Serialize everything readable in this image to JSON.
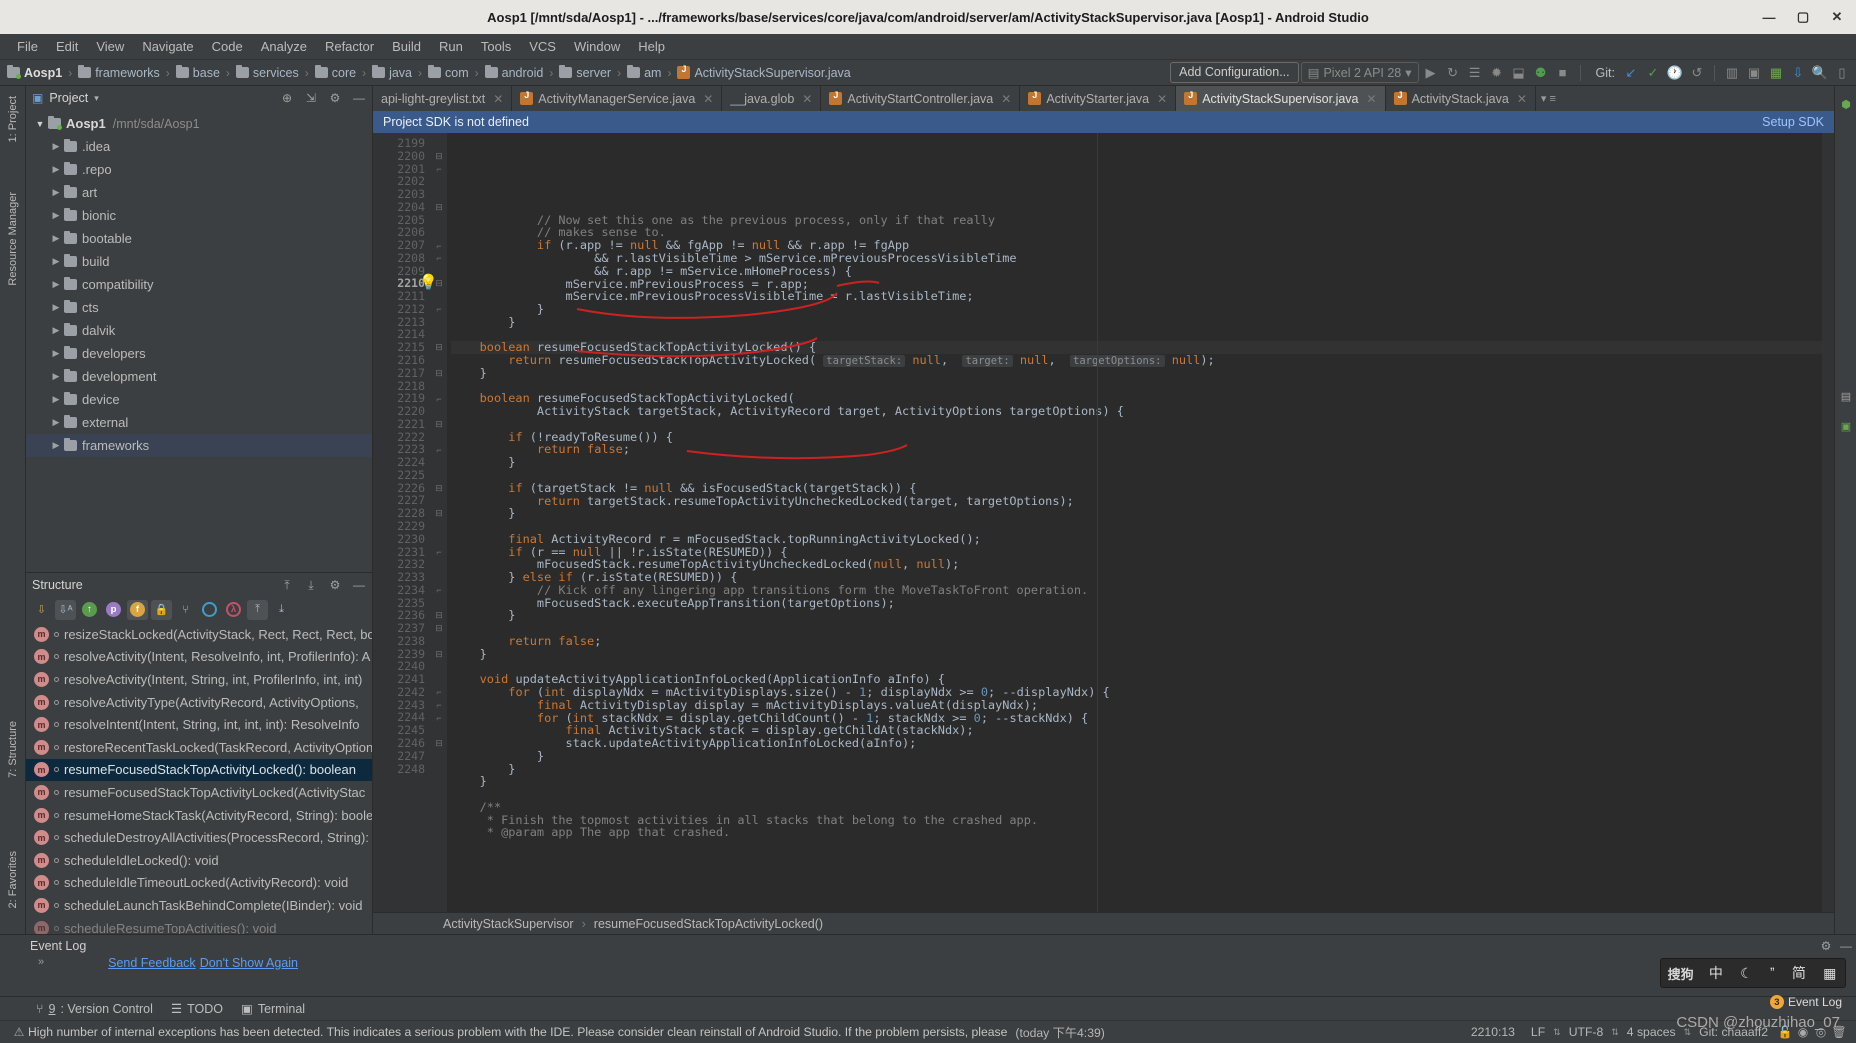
{
  "window": {
    "title": "Aosp1 [/mnt/sda/Aosp1] - .../frameworks/base/services/core/java/com/android/server/am/ActivityStackSupervisor.java [Aosp1] - Android Studio",
    "minimize": "—",
    "maximize": "▢",
    "close": "✕"
  },
  "menubar": {
    "items": [
      "File",
      "Edit",
      "View",
      "Navigate",
      "Code",
      "Analyze",
      "Refactor",
      "Build",
      "Run",
      "Tools",
      "VCS",
      "Window",
      "Help"
    ]
  },
  "navbar": {
    "crumbs": [
      "Aosp1",
      "frameworks",
      "base",
      "services",
      "core",
      "java",
      "com",
      "android",
      "server",
      "am",
      "ActivityStackSupervisor.java"
    ],
    "separator": "›",
    "add_configuration": "Add Configuration...",
    "device": "Pixel 2 API 28",
    "device_caret": "▾",
    "git_label": "Git:",
    "run_icon": "▶",
    "debug_icon": "🐞",
    "stop_icon": "■",
    "apply_changes_icon": "⟳"
  },
  "project_panel": {
    "title": "Project",
    "caret": "▾",
    "root": {
      "name": "Aosp1",
      "path": "/mnt/sda/Aosp1",
      "arrow": "▼"
    },
    "items": [
      {
        "label": ".idea",
        "arrow": "▶"
      },
      {
        "label": ".repo",
        "arrow": "▶"
      },
      {
        "label": "art",
        "arrow": "▶"
      },
      {
        "label": "bionic",
        "arrow": "▶"
      },
      {
        "label": "bootable",
        "arrow": "▶"
      },
      {
        "label": "build",
        "arrow": "▶"
      },
      {
        "label": "compatibility",
        "arrow": "▶"
      },
      {
        "label": "cts",
        "arrow": "▶"
      },
      {
        "label": "dalvik",
        "arrow": "▶"
      },
      {
        "label": "developers",
        "arrow": "▶"
      },
      {
        "label": "development",
        "arrow": "▶"
      },
      {
        "label": "device",
        "arrow": "▶"
      },
      {
        "label": "external",
        "arrow": "▶"
      },
      {
        "label": "frameworks",
        "arrow": "▶"
      }
    ]
  },
  "structure_panel": {
    "title": "Structure",
    "items": [
      {
        "label": "resizeStackLocked(ActivityStack, Rect, Rect, Rect, bo",
        "selected": false
      },
      {
        "label": "resolveActivity(Intent, ResolveInfo, int, ProfilerInfo): A",
        "selected": false
      },
      {
        "label": "resolveActivity(Intent, String, int, ProfilerInfo, int, int)",
        "selected": false
      },
      {
        "label": "resolveActivityType(ActivityRecord, ActivityOptions, ",
        "selected": false
      },
      {
        "label": "resolveIntent(Intent, String, int, int, int): ResolveInfo",
        "selected": false
      },
      {
        "label": "restoreRecentTaskLocked(TaskRecord, ActivityOption",
        "selected": false
      },
      {
        "label": "resumeFocusedStackTopActivityLocked(): boolean",
        "selected": true
      },
      {
        "label": "resumeFocusedStackTopActivityLocked(ActivityStac",
        "selected": false
      },
      {
        "label": "resumeHomeStackTask(ActivityRecord, String): boole",
        "selected": false
      },
      {
        "label": "scheduleDestroyAllActivities(ProcessRecord, String):",
        "selected": false
      },
      {
        "label": "scheduleIdleLocked(): void",
        "selected": false
      },
      {
        "label": "scheduleIdleTimeoutLocked(ActivityRecord): void",
        "selected": false
      },
      {
        "label": "scheduleLaunchTaskBehindComplete(IBinder): void",
        "selected": false
      },
      {
        "label": "scheduleResumeTopActivities(): void",
        "selected": false
      }
    ]
  },
  "tabs": [
    {
      "label": "api-light-greylist.txt",
      "icon": "txt-icon",
      "active": false,
      "closable": true
    },
    {
      "label": "ActivityManagerService.java",
      "icon": "java-icon",
      "active": false,
      "closable": true
    },
    {
      "label": "__java.glob",
      "icon": "file-icon",
      "active": false,
      "closable": true
    },
    {
      "label": "ActivityStartController.java",
      "icon": "java-icon",
      "active": false,
      "closable": true
    },
    {
      "label": "ActivityStarter.java",
      "icon": "java-icon",
      "active": false,
      "closable": true
    },
    {
      "label": "ActivityStackSupervisor.java",
      "icon": "java-icon",
      "active": true,
      "closable": true
    },
    {
      "label": "ActivityStack.java",
      "icon": "java-icon",
      "active": false,
      "closable": true
    }
  ],
  "notification": {
    "message": "Project SDK is not defined",
    "action": "Setup SDK"
  },
  "editor": {
    "first_line": 2199,
    "current_line": 2210,
    "lines": [
      {
        "n": 2199,
        "text": ""
      },
      {
        "n": 2200,
        "text": "            // Now set this one as the previous process, only if that really",
        "cls": "cm",
        "fold": "-"
      },
      {
        "n": 2201,
        "text": "            // makes sense to.",
        "cls": "cm",
        "fold": "|"
      },
      {
        "n": 2202,
        "text": "            if (r.app != null && fgApp != null && r.app != fgApp"
      },
      {
        "n": 2203,
        "text": "                    && r.lastVisibleTime > mService.mPreviousProcessVisibleTime"
      },
      {
        "n": 2204,
        "text": "                    && r.app != mService.mHomeProcess) {",
        "fold": "-"
      },
      {
        "n": 2205,
        "text": "                mService.mPreviousProcess = r.app;"
      },
      {
        "n": 2206,
        "text": "                mService.mPreviousProcessVisibleTime = r.lastVisibleTime;"
      },
      {
        "n": 2207,
        "text": "            }",
        "fold": "|"
      },
      {
        "n": 2208,
        "text": "        }",
        "fold": "|"
      },
      {
        "n": 2209,
        "text": ""
      },
      {
        "n": 2210,
        "text": "    boolean resumeFocusedStackTopActivityLocked() {",
        "fold": "-",
        "current": true
      },
      {
        "n": 2211,
        "text": "        return resumeFocusedStackTopActivityLocked( targetStack: null,  target: null,  targetOptions: null);"
      },
      {
        "n": 2212,
        "text": "    }",
        "fold": "|"
      },
      {
        "n": 2213,
        "text": ""
      },
      {
        "n": 2214,
        "text": "    boolean resumeFocusedStackTopActivityLocked("
      },
      {
        "n": 2215,
        "text": "            ActivityStack targetStack, ActivityRecord target, ActivityOptions targetOptions) {",
        "fold": "-"
      },
      {
        "n": 2216,
        "text": ""
      },
      {
        "n": 2217,
        "text": "        if (!readyToResume()) {",
        "fold": "-"
      },
      {
        "n": 2218,
        "text": "            return false;"
      },
      {
        "n": 2219,
        "text": "        }",
        "fold": "|"
      },
      {
        "n": 2220,
        "text": ""
      },
      {
        "n": 2221,
        "text": "        if (targetStack != null && isFocusedStack(targetStack)) {",
        "fold": "-"
      },
      {
        "n": 2222,
        "text": "            return targetStack.resumeTopActivityUncheckedLocked(target, targetOptions);"
      },
      {
        "n": 2223,
        "text": "        }",
        "fold": "|"
      },
      {
        "n": 2224,
        "text": ""
      },
      {
        "n": 2225,
        "text": "        final ActivityRecord r = mFocusedStack.topRunningActivityLocked();"
      },
      {
        "n": 2226,
        "text": "        if (r == null || !r.isState(RESUMED)) {",
        "fold": "-"
      },
      {
        "n": 2227,
        "text": "            mFocusedStack.resumeTopActivityUncheckedLocked(null, null);"
      },
      {
        "n": 2228,
        "text": "        } else if (r.isState(RESUMED)) {",
        "fold": "-"
      },
      {
        "n": 2229,
        "text": "            // Kick off any lingering app transitions form the MoveTaskToFront operation.",
        "cls": "cm"
      },
      {
        "n": 2230,
        "text": "            mFocusedStack.executeAppTransition(targetOptions);"
      },
      {
        "n": 2231,
        "text": "        }",
        "fold": "|"
      },
      {
        "n": 2232,
        "text": ""
      },
      {
        "n": 2233,
        "text": "        return false;"
      },
      {
        "n": 2234,
        "text": "    }",
        "fold": "|"
      },
      {
        "n": 2235,
        "text": ""
      },
      {
        "n": 2236,
        "text": "    void updateActivityApplicationInfoLocked(ApplicationInfo aInfo) {",
        "fold": "-"
      },
      {
        "n": 2237,
        "text": "        for (int displayNdx = mActivityDisplays.size() - 1; displayNdx >= 0; --displayNdx) {",
        "fold": "-"
      },
      {
        "n": 2238,
        "text": "            final ActivityDisplay display = mActivityDisplays.valueAt(displayNdx);"
      },
      {
        "n": 2239,
        "text": "            for (int stackNdx = display.getChildCount() - 1; stackNdx >= 0; --stackNdx) {",
        "fold": "-"
      },
      {
        "n": 2240,
        "text": "                final ActivityStack stack = display.getChildAt(stackNdx);"
      },
      {
        "n": 2241,
        "text": "                stack.updateActivityApplicationInfoLocked(aInfo);"
      },
      {
        "n": 2242,
        "text": "            }",
        "fold": "|"
      },
      {
        "n": 2243,
        "text": "        }",
        "fold": "|"
      },
      {
        "n": 2244,
        "text": "    }",
        "fold": "|"
      },
      {
        "n": 2245,
        "text": ""
      },
      {
        "n": 2246,
        "text": "    /**",
        "cls": "cm",
        "fold": "-"
      },
      {
        "n": 2247,
        "text": "     * Finish the topmost activities in all stacks that belong to the crashed app.",
        "cls": "cm"
      },
      {
        "n": 2248,
        "text": "     * @param app The app that crashed.",
        "cls": "cm"
      }
    ]
  },
  "editor_breadcrumb": {
    "class": "ActivityStackSupervisor",
    "separator": "›",
    "method": "resumeFocusedStackTopActivityLocked()"
  },
  "event_log": {
    "title": "Event Log",
    "links": [
      "Send Feedback",
      "Don't Show Again"
    ],
    "expand": "»"
  },
  "ime_bar": {
    "items": [
      "中",
      "☾",
      "ˮ",
      "简",
      "▦"
    ],
    "logo": "搜狗"
  },
  "bottom_tool_windows": [
    {
      "num": "9",
      "label": ": Version Control",
      "icon": "branch-icon"
    },
    {
      "num": "",
      "label": "TODO",
      "icon": "todo-icon"
    },
    {
      "num": "",
      "label": "Terminal",
      "icon": "terminal-icon"
    }
  ],
  "left_rail": [
    {
      "label": "1: Project"
    },
    {
      "label": "Resource Manager"
    },
    {
      "label": "7: Structure"
    },
    {
      "label": "2: Favorites"
    }
  ],
  "statusbar": {
    "message": "High number of internal exceptions has been detected. This indicates a serious problem with the IDE. Please consider clean reinstall of Android Studio. If the problem persists, please",
    "time": "(today 下午4:39)",
    "caret": "2210:13",
    "line_sep": "LF",
    "encoding": "UTF-8",
    "indent": "4 spaces",
    "git_branch": "Git: chaaaff2",
    "event_log_badge": "3",
    "event_log_label": "Event Log",
    "watermark": "CSDN @zhouzhihao_07"
  }
}
